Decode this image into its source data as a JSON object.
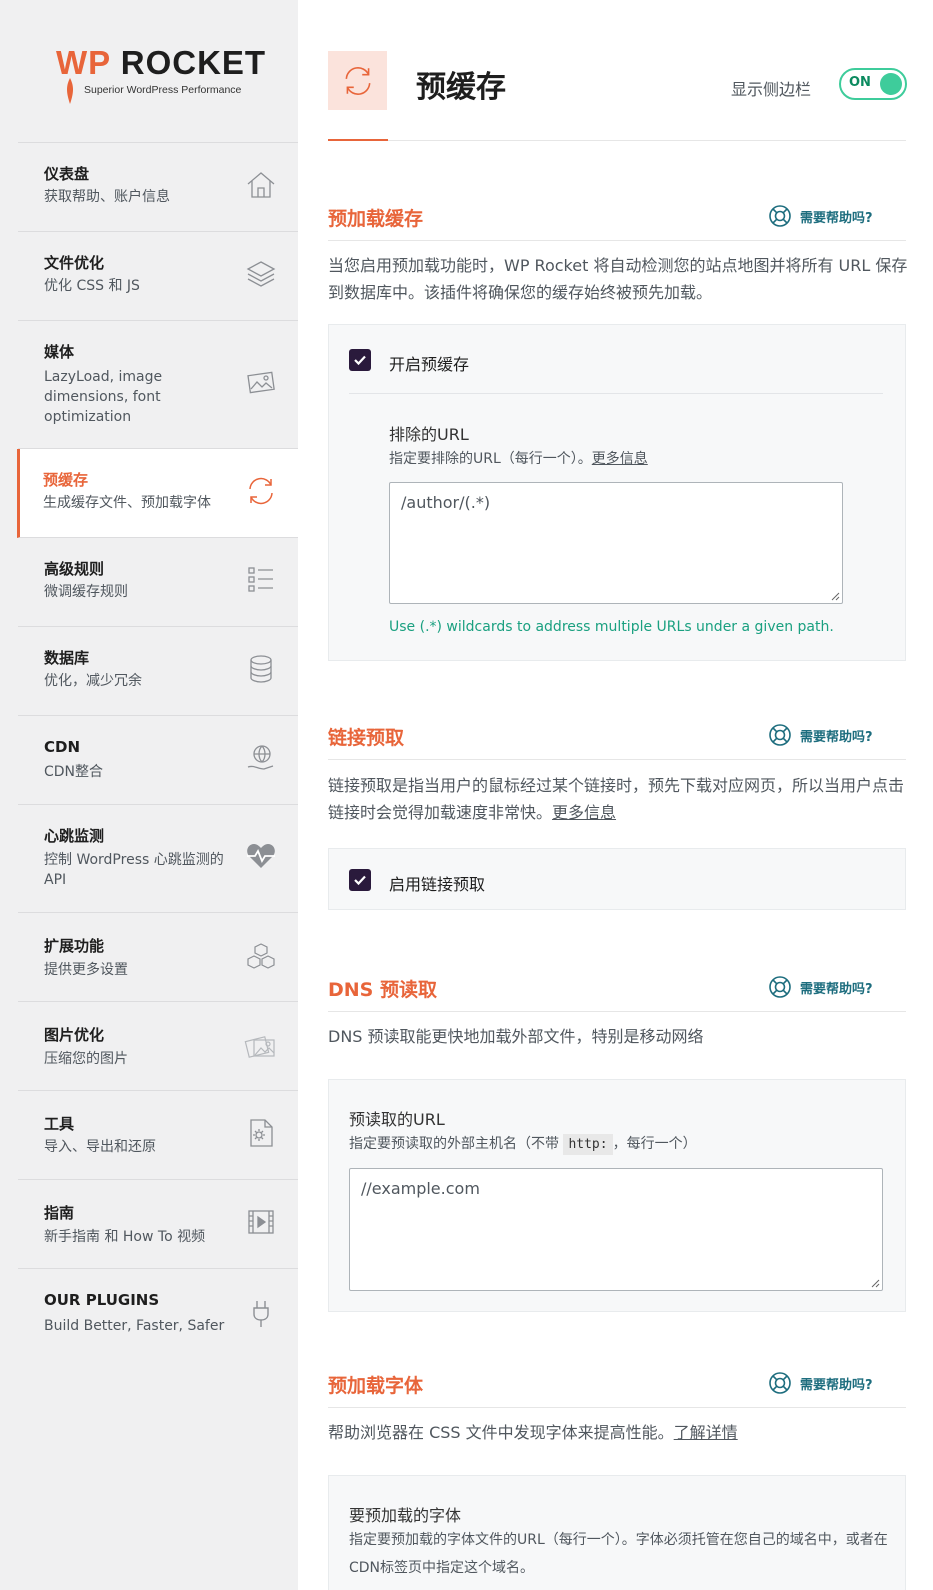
{
  "brand": {
    "logo_wp": "WP",
    "logo_rocket": " ROCKET",
    "tagline": "Superior WordPress Performance"
  },
  "sidebar": {
    "items": [
      {
        "title": "仪表盘",
        "desc": "获取帮助、账户信息",
        "icon": "home-icon"
      },
      {
        "title": "文件优化",
        "desc": "优化 CSS 和 JS",
        "icon": "layers-icon"
      },
      {
        "title": "媒体",
        "desc": "LazyLoad, image dimensions, font optimization",
        "icon": "image-icon"
      },
      {
        "title": "预缓存",
        "desc": "生成缓存文件、预加载字体",
        "icon": "refresh-icon"
      },
      {
        "title": "高级规则",
        "desc": "微调缓存规则",
        "icon": "list-icon"
      },
      {
        "title": "数据库",
        "desc": "优化，减少冗余",
        "icon": "database-icon"
      },
      {
        "title": "CDN",
        "desc": "CDN整合",
        "icon": "globe-hand-icon"
      },
      {
        "title": "心跳监测",
        "desc": "控制 WordPress 心跳监测的 API",
        "icon": "heartbeat-icon"
      },
      {
        "title": "扩展功能",
        "desc": "提供更多设置",
        "icon": "cubes-icon"
      },
      {
        "title": "图片优化",
        "desc": "压缩您的图片",
        "icon": "photos-icon"
      },
      {
        "title": "工具",
        "desc": "导入、导出和还原",
        "icon": "file-gear-icon"
      },
      {
        "title": "指南",
        "desc": "新手指南 和 How To 视频",
        "icon": "video-icon"
      },
      {
        "title": "OUR PLUGINS",
        "desc": "Build Better, Faster, Safer",
        "icon": "plug-icon"
      }
    ]
  },
  "header": {
    "title": "预缓存",
    "sidebar_toggle_label": "显示侧边栏",
    "toggle_state": "ON"
  },
  "help_label": "需要帮助吗?",
  "sections": {
    "preload_cache": {
      "title": "预加载缓存",
      "desc": "当您启用预加载功能时，WP Rocket 将自动检测您的站点地图并将所有 URL 保存到数据库中。该插件将确保您的缓存始终被预先加载。",
      "checkbox_label": "开启预缓存",
      "exclude_label": "排除的URL",
      "exclude_desc": "指定要排除的URL（每行一个）。",
      "more_info": "更多信息",
      "exclude_value": "/author/(.*)",
      "hint": "Use (.*) wildcards to address multiple URLs under a given path."
    },
    "link_prefetch": {
      "title": "链接预取",
      "desc": "链接预取是指当用户的鼠标经过某个链接时，预先下载对应网页，所以当用户点击链接时会觉得加载速度非常快。",
      "more_info": "更多信息",
      "checkbox_label": "启用链接预取"
    },
    "dns_prefetch": {
      "title": "DNS 预读取",
      "desc": "DNS 预读取能更快地加载外部文件，特别是移动网络",
      "field_label": "预读取的URL",
      "field_desc_pre": "指定要预读取的外部主机名（不带",
      "field_desc_code": "http:",
      "field_desc_post": "，每行一个）",
      "value": "//example.com"
    },
    "preload_fonts": {
      "title": "预加载字体",
      "desc": "帮助浏览器在 CSS 文件中发现字体来提高性能。",
      "learn_more": "了解详情",
      "field_label": "要预加载的字体",
      "field_desc": "指定要预加载的字体文件的URL（每行一个）。字体必须托管在您自己的域名中，或者在CDN标签页中指定这个域名。"
    }
  },
  "colors": {
    "accent": "#e8653a",
    "toggle_on": "#3ecc9b",
    "help": "#1d6d7e",
    "hint": "#1aa080",
    "checkbox": "#2a1a3c"
  }
}
